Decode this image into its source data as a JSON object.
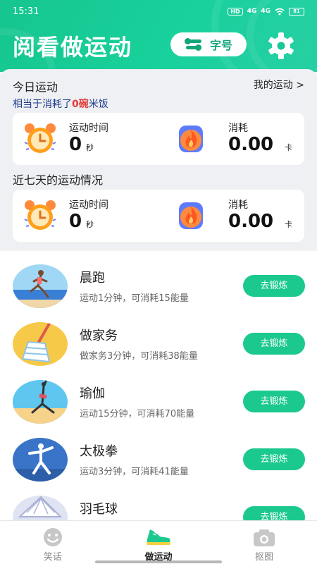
{
  "status_bar": {
    "time": "15:31",
    "hd": "HD",
    "net1": "4G",
    "net2": "4G",
    "battery": "81"
  },
  "header": {
    "title": "阅看做运动",
    "font_button": "字号"
  },
  "today": {
    "title": "今日运动",
    "link": "我的运动 >",
    "equiv_prefix": "相当于消耗了",
    "equiv_value": "0碗",
    "equiv_suffix": "米饭",
    "time_label": "运动时间",
    "time_value": "0",
    "time_unit": "秒",
    "cal_label": "消耗",
    "cal_value": "0.00",
    "cal_unit": "卡"
  },
  "week": {
    "title": "近七天的运动情况",
    "time_label": "运动时间",
    "time_value": "0",
    "time_unit": "秒",
    "cal_label": "消耗",
    "cal_value": "0.00",
    "cal_unit": "卡"
  },
  "activities": [
    {
      "name": "晨跑",
      "desc": "运动1分钟，可消耗15能量",
      "button": "去锻炼"
    },
    {
      "name": "做家务",
      "desc": "做家务3分钟，可消耗38能量",
      "button": "去锻炼"
    },
    {
      "name": "瑜伽",
      "desc": "运动15分钟，可消耗70能量",
      "button": "去锻炼"
    },
    {
      "name": "太极拳",
      "desc": "运动3分钟，可消耗41能量",
      "button": "去锻炼"
    },
    {
      "name": "羽毛球",
      "desc": "",
      "button": "去锻炼"
    }
  ],
  "nav": [
    {
      "label": "笑话",
      "icon": "smile-icon"
    },
    {
      "label": "做运动",
      "icon": "sneaker-icon"
    },
    {
      "label": "抠图",
      "icon": "camera-icon"
    }
  ],
  "colors": {
    "brand": "#1bc98e",
    "header": "#18c996",
    "highlight": "#e53935",
    "link_text": "#1f3b8c"
  }
}
